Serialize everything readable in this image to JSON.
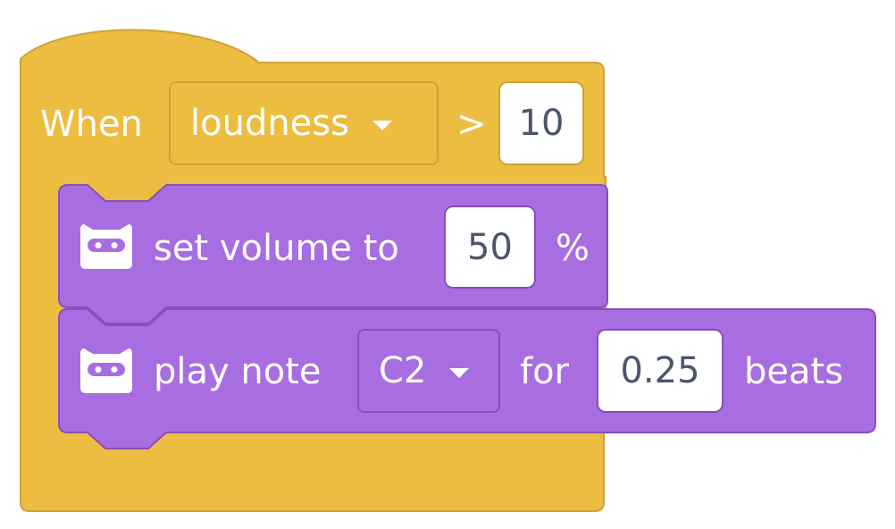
{
  "colors": {
    "event_block": "#ecbd40",
    "event_border": "#cda238",
    "action_block": "#a86de1",
    "action_border": "#8650b8",
    "input_text": "#4c566a"
  },
  "hat_block": {
    "label": "When",
    "sensor_dropdown": "loudness",
    "operator": ">",
    "threshold": "10"
  },
  "blocks": [
    {
      "icon": "robot-face-icon",
      "label": "set volume to",
      "value": "50",
      "unit": "%"
    },
    {
      "icon": "robot-face-icon",
      "label": "play note",
      "note_dropdown": "C2",
      "for_label": "for",
      "duration": "0.25",
      "beats_label": "beats"
    }
  ]
}
